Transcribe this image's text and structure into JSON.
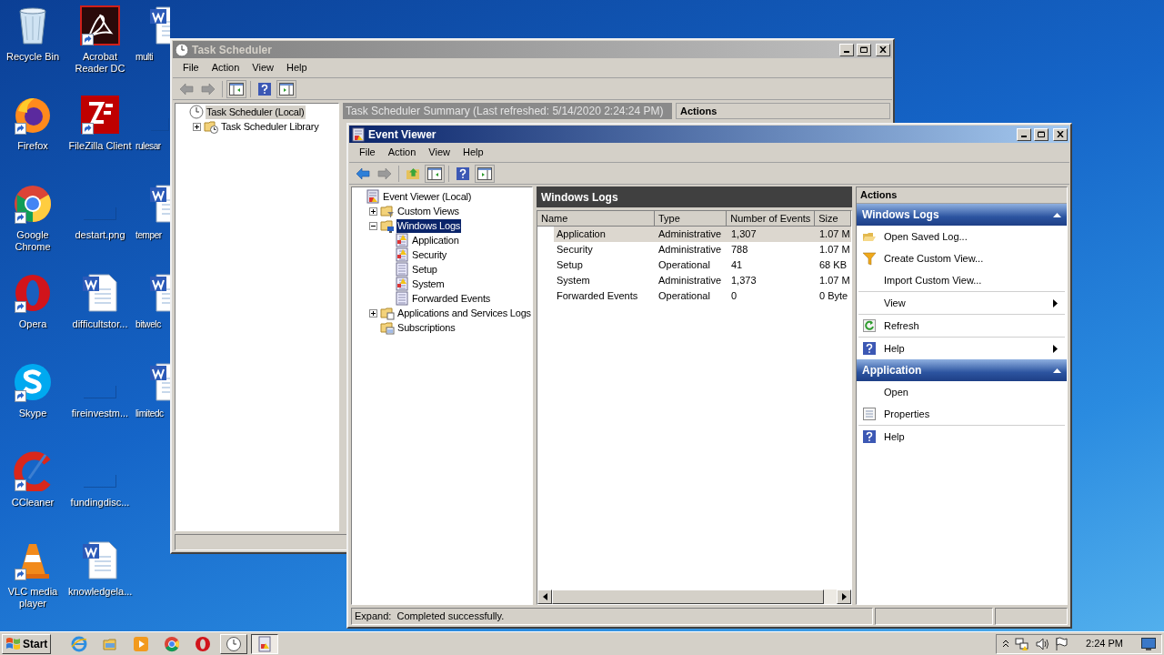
{
  "desktop": {
    "columns": [
      [
        {
          "label": "Recycle Bin",
          "kind": "recycle",
          "shortcut": false
        },
        {
          "label": "Firefox",
          "kind": "firefox",
          "shortcut": true
        },
        {
          "label": "Google Chrome",
          "kind": "chrome",
          "shortcut": true
        },
        {
          "label": "Opera",
          "kind": "opera",
          "shortcut": true
        },
        {
          "label": "Skype",
          "kind": "skype",
          "shortcut": true
        },
        {
          "label": "CCleaner",
          "kind": "ccleaner",
          "shortcut": true
        },
        {
          "label": "VLC media player",
          "kind": "vlc",
          "shortcut": true
        }
      ],
      [
        {
          "label": "Acrobat Reader DC",
          "kind": "acrobat",
          "shortcut": true
        },
        {
          "label": "FileZilla Client",
          "kind": "filezilla",
          "shortcut": true
        },
        {
          "label": "destart.png",
          "kind": "blank",
          "shortcut": false
        },
        {
          "label": "difficultstor...",
          "kind": "word",
          "shortcut": false
        },
        {
          "label": "fireinvestm...",
          "kind": "blank",
          "shortcut": false
        },
        {
          "label": "fundingdisc...",
          "kind": "blank",
          "shortcut": false
        },
        {
          "label": "knowledgela...",
          "kind": "word",
          "shortcut": false
        }
      ],
      [
        {
          "label": "multi",
          "kind": "word",
          "shortcut": false
        },
        {
          "label": "rulesar",
          "kind": "blank",
          "shortcut": false
        },
        {
          "label": "temper",
          "kind": "word",
          "shortcut": false
        },
        {
          "label": "bitwelc",
          "kind": "word",
          "shortcut": false
        },
        {
          "label": "limitedc",
          "kind": "word",
          "shortcut": false
        }
      ]
    ]
  },
  "task_scheduler": {
    "title": "Task Scheduler",
    "active": false,
    "nav_enabled": false,
    "menu": [
      "File",
      "Action",
      "View",
      "Help"
    ],
    "tree": [
      {
        "label": "Task Scheduler (Local)",
        "kind": "clock",
        "selected": true,
        "children": [
          {
            "label": "Task Scheduler Library",
            "kind": "folder-clock",
            "expanded": false,
            "selected": false
          }
        ]
      }
    ],
    "summary_header": "Task Scheduler Summary (Last refreshed: 5/14/2020 2:24:24 PM)",
    "actions_header": "Actions"
  },
  "event_viewer": {
    "title": "Event Viewer",
    "active": true,
    "nav_enabled": true,
    "menu": [
      "File",
      "Action",
      "View",
      "Help"
    ],
    "tree": [
      {
        "label": "Event Viewer (Local)",
        "kind": "viewer",
        "selected": false,
        "children": [
          {
            "label": "Custom Views",
            "kind": "folder-filter",
            "expanded": false,
            "selected": false
          },
          {
            "label": "Windows Logs",
            "kind": "folder-logs",
            "expanded": true,
            "selected": true,
            "children": [
              {
                "label": "Application",
                "kind": "log-warn",
                "selected": false
              },
              {
                "label": "Security",
                "kind": "log-warn",
                "selected": false
              },
              {
                "label": "Setup",
                "kind": "log",
                "selected": false
              },
              {
                "label": "System",
                "kind": "log-warn",
                "selected": false
              },
              {
                "label": "Forwarded Events",
                "kind": "log",
                "selected": false
              }
            ]
          },
          {
            "label": "Applications and Services Logs",
            "kind": "folder-apps",
            "expanded": false,
            "selected": false
          },
          {
            "label": "Subscriptions",
            "kind": "subscriptions",
            "selected": false
          }
        ]
      }
    ],
    "pane_header": "Windows Logs",
    "table": {
      "columns": [
        "Name",
        "Type",
        "Number of Events",
        "Size"
      ],
      "rows": [
        {
          "cells": [
            "Application",
            "Administrative",
            "1,307",
            "1.07 M"
          ],
          "selected": true
        },
        {
          "cells": [
            "Security",
            "Administrative",
            "788",
            "1.07 M"
          ],
          "selected": false
        },
        {
          "cells": [
            "Setup",
            "Operational",
            "41",
            "68 KB"
          ],
          "selected": false
        },
        {
          "cells": [
            "System",
            "Administrative",
            "1,373",
            "1.07 M"
          ],
          "selected": false
        },
        {
          "cells": [
            "Forwarded Events",
            "Operational",
            "0",
            "0 Byte"
          ],
          "selected": false
        }
      ]
    },
    "actions_header": "Actions",
    "action_sections": [
      {
        "title": "Windows Logs",
        "expanded": true,
        "items": [
          {
            "label": "Open Saved Log...",
            "kind": "folder-open",
            "submenu": false,
            "separator_before": false
          },
          {
            "label": "Create Custom View...",
            "kind": "filter",
            "submenu": false,
            "separator_before": false
          },
          {
            "label": "Import Custom View...",
            "kind": "plain",
            "submenu": false,
            "separator_before": false
          },
          {
            "label": "View",
            "kind": "plain",
            "submenu": true,
            "separator_before": true
          },
          {
            "label": "Refresh",
            "kind": "refresh",
            "submenu": false,
            "separator_before": true
          },
          {
            "label": "Help",
            "kind": "help",
            "submenu": true,
            "separator_before": true
          }
        ]
      },
      {
        "title": "Application",
        "expanded": true,
        "items": [
          {
            "label": "Open",
            "kind": "plain",
            "submenu": false,
            "separator_before": false
          },
          {
            "label": "Properties",
            "kind": "properties",
            "submenu": false,
            "separator_before": false
          },
          {
            "label": "Help",
            "kind": "help",
            "submenu": false,
            "separator_before": true
          }
        ]
      }
    ],
    "status": "Expand:  Completed successfully."
  },
  "taskbar": {
    "start": "Start",
    "buttons": [
      {
        "kind": "ie",
        "running": false,
        "selected": false
      },
      {
        "kind": "explorer",
        "running": false,
        "selected": false
      },
      {
        "kind": "media",
        "running": false,
        "selected": false
      },
      {
        "kind": "chrome",
        "running": false,
        "selected": false
      },
      {
        "kind": "opera",
        "running": false,
        "selected": false
      },
      {
        "kind": "clock",
        "running": true,
        "selected": false
      },
      {
        "kind": "viewer",
        "running": true,
        "selected": true
      }
    ],
    "clock": "2:24 PM"
  }
}
